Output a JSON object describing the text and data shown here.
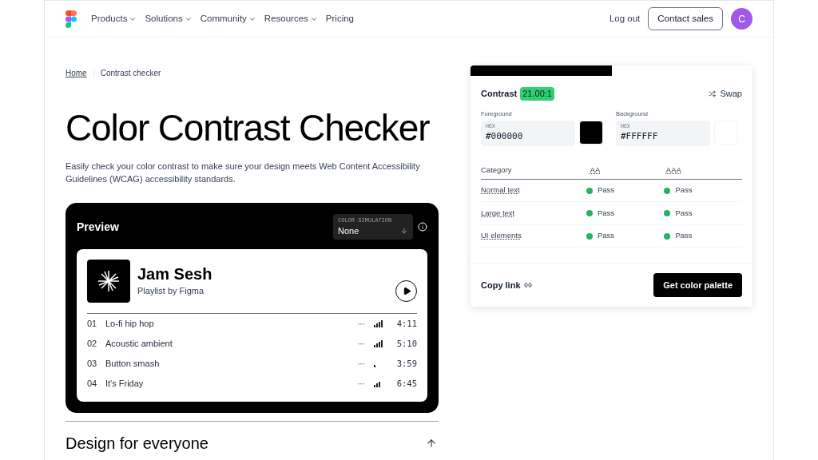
{
  "nav": {
    "items": [
      {
        "label": "Products",
        "dropdown": true
      },
      {
        "label": "Solutions",
        "dropdown": true
      },
      {
        "label": "Community",
        "dropdown": true
      },
      {
        "label": "Resources",
        "dropdown": true
      },
      {
        "label": "Pricing",
        "dropdown": false
      }
    ],
    "logout": "Log out",
    "contact": "Contact sales",
    "avatar": "C"
  },
  "breadcrumb": [
    {
      "label": "Home",
      "link": true
    },
    {
      "label": "Contrast checker",
      "link": false
    }
  ],
  "title": "Color Contrast Checker",
  "description": "Easily check your color contrast to make sure your design meets Web Content Accessibility Guidelines (WCAG) accessibility standards.",
  "preview": {
    "title": "Preview",
    "simulation_label": "COLOR SIMULATION",
    "simulation_value": "None",
    "playlist": {
      "name": "Jam Sesh",
      "subtitle": "Playlist by Figma",
      "tracks": [
        {
          "number": "01",
          "name": "Lo-fi hip hop",
          "more": "···",
          "kind": "strong",
          "time": "4:11"
        },
        {
          "number": "02",
          "name": "Acoustic ambient",
          "more": "···",
          "kind": "strong",
          "time": "5:10"
        },
        {
          "number": "03",
          "name": "Button smash",
          "more": "···",
          "kind": "weak",
          "time": "3:59"
        },
        {
          "number": "04",
          "name": "It's Friday",
          "more": "···",
          "kind": "medium",
          "time": "6:45"
        }
      ]
    }
  },
  "section_heading": "Design for everyone",
  "checker": {
    "contrast_label": "Contrast",
    "ratio": "21.00:1",
    "swap": "Swap",
    "colors": [
      {
        "label": "Foreground",
        "hex_label": "HEX",
        "value": "#000000",
        "color": "#000000"
      },
      {
        "label": "Background",
        "hex_label": "HEX",
        "value": "#FFFFFF",
        "color": "#ffffff"
      }
    ],
    "columns": [
      "Category",
      "AA",
      "AAA"
    ],
    "rows": [
      {
        "category": "Normal text",
        "aa": "Pass",
        "aaa": "Pass"
      },
      {
        "category": "Large text",
        "aa": "Pass",
        "aaa": "Pass"
      },
      {
        "category": "UI elements",
        "aa": "Pass",
        "aaa": "Pass"
      }
    ],
    "copy_link": "Copy link",
    "palette_button": "Get color palette"
  }
}
